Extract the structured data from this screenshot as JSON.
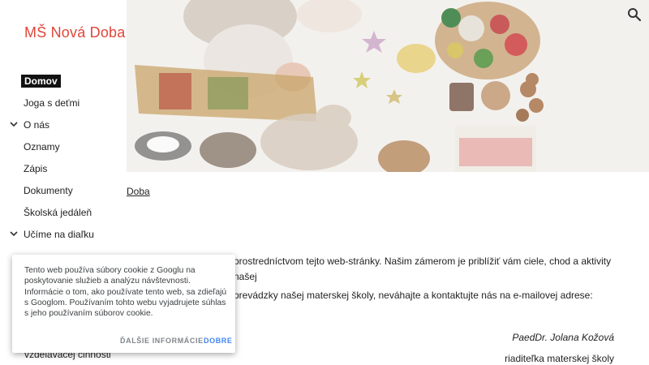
{
  "site": {
    "title": "MŠ Nová Doba"
  },
  "nav": {
    "items": [
      {
        "label": "Domov",
        "active": true,
        "expandable": false
      },
      {
        "label": "Joga s deťmi",
        "active": false,
        "expandable": false
      },
      {
        "label": "O nás",
        "active": false,
        "expandable": true
      },
      {
        "label": "Oznamy",
        "active": false,
        "expandable": false
      },
      {
        "label": "Zápis",
        "active": false,
        "expandable": false
      },
      {
        "label": "Dokumenty",
        "active": false,
        "expandable": false
      },
      {
        "label": "Školská jedáleň",
        "active": false,
        "expandable": false
      },
      {
        "label": "Učíme na diaľku",
        "active": false,
        "expandable": true
      }
    ],
    "partial_item": "vzdelávacej činnosti"
  },
  "main": {
    "breadcrumb": "Doba",
    "paragraph1": "prostredníctvom tejto web-stránky. Našim zámerom je priblížiť vám ciele, chod a aktivity našej",
    "paragraph2": "prevádzky našej materskej školy, neváhajte a kontaktujte nás na e-mailovej adrese:",
    "signature_name": "PaedDr. Jolana Kožová",
    "signature_role": "riaditeľka materskej školy"
  },
  "cookie": {
    "text": "Tento web používa súbory cookie z Googlu na poskytovanie služieb a analýzu návštevnosti. Informácie o tom, ako používate tento web, sa zdieľajú s Googlom. Používaním tohto webu vyjadrujete súhlas s jeho používaním súborov cookie.",
    "more_label": "ĎALŠIE INFORMÁCIE",
    "ok_label": "DOBRE"
  },
  "icons": {
    "search": "search-icon",
    "chevron": "chevron-down-icon"
  },
  "colors": {
    "title": "#e0463a",
    "accent": "#4285f4"
  }
}
